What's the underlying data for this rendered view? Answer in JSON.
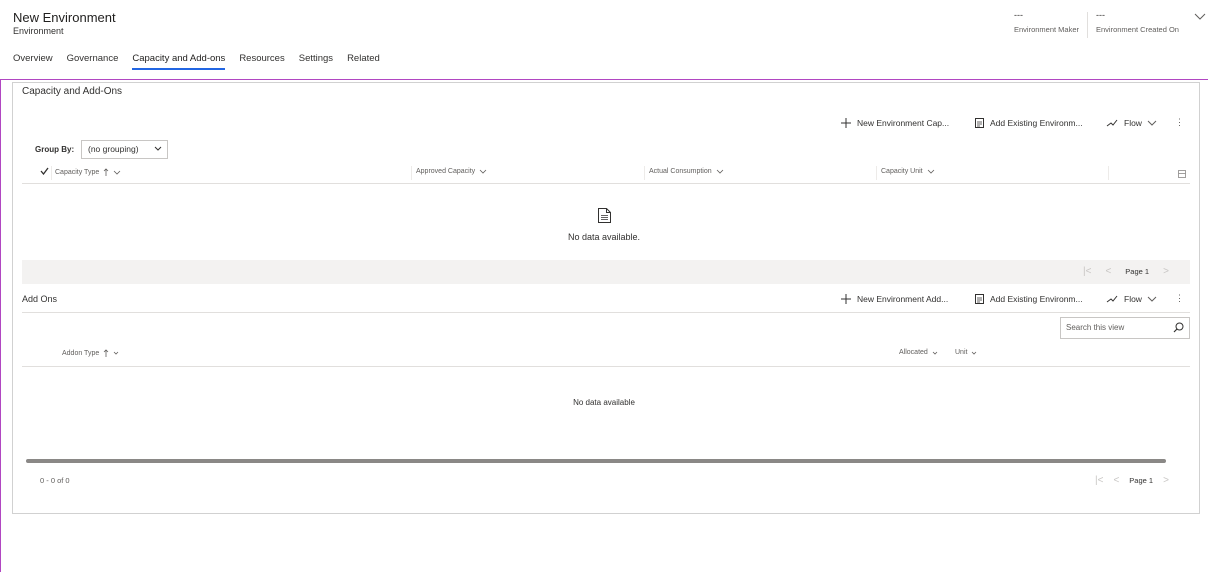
{
  "header": {
    "title": "New Environment",
    "subtitle": "Environment",
    "fields": [
      {
        "value": "---",
        "label": "Environment Maker"
      },
      {
        "value": "---",
        "label": "Environment Created On"
      }
    ]
  },
  "tabs": [
    {
      "label": "Overview",
      "active": false
    },
    {
      "label": "Governance",
      "active": false
    },
    {
      "label": "Capacity and Add-ons",
      "active": true
    },
    {
      "label": "Resources",
      "active": false
    },
    {
      "label": "Settings",
      "active": false
    },
    {
      "label": "Related",
      "active": false
    }
  ],
  "capacity": {
    "section_title": "Capacity and Add-Ons",
    "commands": {
      "new": "New Environment Cap...",
      "existing": "Add Existing Environm...",
      "flow": "Flow",
      "more": "⋮"
    },
    "group_by": {
      "label": "Group By:",
      "value": "(no grouping)"
    },
    "columns": [
      "Capacity Type",
      "Approved Capacity",
      "Actual Consumption",
      "Capacity Unit"
    ],
    "empty_text": "No data available.",
    "pager": {
      "page": "Page 1"
    }
  },
  "addons": {
    "title": "Add Ons",
    "commands": {
      "new": "New Environment Add...",
      "existing": "Add Existing Environm...",
      "flow": "Flow",
      "more": "⋮"
    },
    "search_placeholder": "Search this view",
    "columns": [
      "Addon Type",
      "Allocated",
      "Unit"
    ],
    "empty_text": "No data available",
    "count": "0 - 0 of 0",
    "pager": {
      "page": "Page 1"
    }
  },
  "colors": {
    "accent": "#2266e3",
    "focus_border": "#b146c2",
    "border": "#d1d1d1",
    "pager_bg": "#f3f2f1"
  }
}
